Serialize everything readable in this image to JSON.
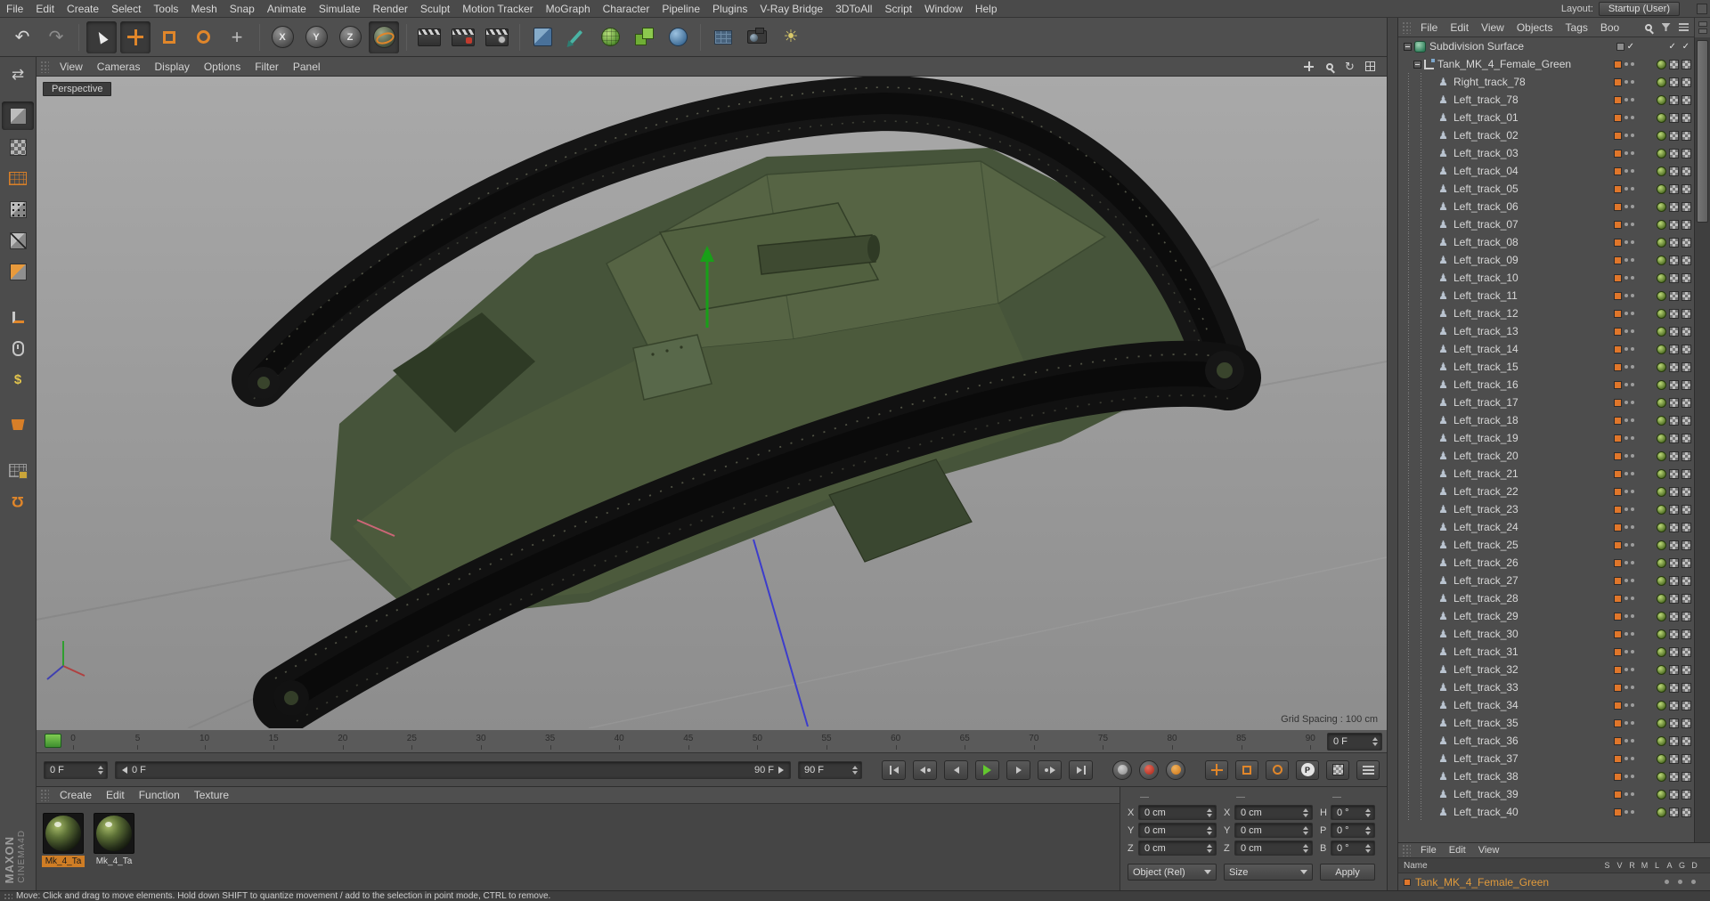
{
  "menubar": {
    "items": [
      "File",
      "Edit",
      "Create",
      "Select",
      "Tools",
      "Mesh",
      "Snap",
      "Animate",
      "Simulate",
      "Render",
      "Sculpt",
      "Motion Tracker",
      "MoGraph",
      "Character",
      "Pipeline",
      "Plugins",
      "V-Ray Bridge",
      "3DToAll",
      "Script",
      "Window",
      "Help"
    ],
    "layout_label": "Layout:",
    "layout_value": "Startup (User)"
  },
  "toolbar": {
    "axis_x": "X",
    "axis_y": "Y",
    "axis_z": "Z"
  },
  "viewport": {
    "menu": [
      "View",
      "Cameras",
      "Display",
      "Options",
      "Filter",
      "Panel"
    ],
    "label": "Perspective",
    "grid_spacing": "Grid Spacing : 100 cm"
  },
  "timeline": {
    "ticks": [
      "0",
      "5",
      "10",
      "15",
      "20",
      "25",
      "30",
      "35",
      "40",
      "45",
      "50",
      "55",
      "60",
      "65",
      "70",
      "75",
      "80",
      "85",
      "90"
    ],
    "ruler_field": "0 F",
    "frame_spinner": "0 F",
    "range_start": "0 F",
    "range_end": "90 F",
    "end_spinner": "90 F",
    "pla_label": "P"
  },
  "materials": {
    "menu": [
      "Create",
      "Edit",
      "Function",
      "Texture"
    ],
    "items": [
      {
        "name": "Mk_4_Ta",
        "state": "selected"
      },
      {
        "name": "Mk_4_Ta",
        "state": "plain"
      }
    ]
  },
  "coordinates": {
    "dash": "—",
    "rows": [
      {
        "l1": "X",
        "v1": "0 cm",
        "l2": "X",
        "v2": "0 cm",
        "l3": "H",
        "v3": "0 °"
      },
      {
        "l1": "Y",
        "v1": "0 cm",
        "l2": "Y",
        "v2": "0 cm",
        "l3": "P",
        "v3": "0 °"
      },
      {
        "l1": "Z",
        "v1": "0 cm",
        "l2": "Z",
        "v2": "0 cm",
        "l3": "B",
        "v3": "0 °"
      }
    ],
    "dropdown_object": "Object (Rel)",
    "dropdown_size": "Size",
    "apply_label": "Apply"
  },
  "object_manager": {
    "menu": [
      "File",
      "Edit",
      "View",
      "Objects",
      "Tags",
      "Boo"
    ],
    "tree": [
      {
        "label": "Subdivision Surface",
        "type": "gen"
      },
      {
        "label": "Tank_MK_4_Female_Green",
        "type": "nullobj"
      },
      {
        "label": "Right_track_78",
        "type": "track"
      },
      {
        "label": "Left_track_78",
        "type": "track"
      },
      {
        "label": "Left_track_01",
        "type": "track"
      },
      {
        "label": "Left_track_02",
        "type": "track"
      },
      {
        "label": "Left_track_03",
        "type": "track"
      },
      {
        "label": "Left_track_04",
        "type": "track"
      },
      {
        "label": "Left_track_05",
        "type": "track"
      },
      {
        "label": "Left_track_06",
        "type": "track"
      },
      {
        "label": "Left_track_07",
        "type": "track"
      },
      {
        "label": "Left_track_08",
        "type": "track"
      },
      {
        "label": "Left_track_09",
        "type": "track"
      },
      {
        "label": "Left_track_10",
        "type": "track"
      },
      {
        "label": "Left_track_11",
        "type": "track"
      },
      {
        "label": "Left_track_12",
        "type": "track"
      },
      {
        "label": "Left_track_13",
        "type": "track"
      },
      {
        "label": "Left_track_14",
        "type": "track"
      },
      {
        "label": "Left_track_15",
        "type": "track"
      },
      {
        "label": "Left_track_16",
        "type": "track"
      },
      {
        "label": "Left_track_17",
        "type": "track"
      },
      {
        "label": "Left_track_18",
        "type": "track"
      },
      {
        "label": "Left_track_19",
        "type": "track"
      },
      {
        "label": "Left_track_20",
        "type": "track"
      },
      {
        "label": "Left_track_21",
        "type": "track"
      },
      {
        "label": "Left_track_22",
        "type": "track"
      },
      {
        "label": "Left_track_23",
        "type": "track"
      },
      {
        "label": "Left_track_24",
        "type": "track"
      },
      {
        "label": "Left_track_25",
        "type": "track"
      },
      {
        "label": "Left_track_26",
        "type": "track"
      },
      {
        "label": "Left_track_27",
        "type": "track"
      },
      {
        "label": "Left_track_28",
        "type": "track"
      },
      {
        "label": "Left_track_29",
        "type": "track"
      },
      {
        "label": "Left_track_30",
        "type": "track"
      },
      {
        "label": "Left_track_31",
        "type": "track"
      },
      {
        "label": "Left_track_32",
        "type": "track"
      },
      {
        "label": "Left_track_33",
        "type": "track"
      },
      {
        "label": "Left_track_34",
        "type": "track"
      },
      {
        "label": "Left_track_35",
        "type": "track"
      },
      {
        "label": "Left_track_36",
        "type": "track"
      },
      {
        "label": "Left_track_37",
        "type": "track"
      },
      {
        "label": "Left_track_38",
        "type": "track"
      },
      {
        "label": "Left_track_39",
        "type": "track"
      },
      {
        "label": "Left_track_40",
        "type": "track"
      }
    ]
  },
  "attribute_panel": {
    "menu": [
      "File",
      "Edit",
      "View"
    ],
    "name_header": "Name",
    "columns": [
      "S",
      "V",
      "R",
      "M",
      "L",
      "A",
      "G",
      "D"
    ],
    "row_name": "Tank_MK_4_Female_Green"
  },
  "status_bar": {
    "text": "Move: Click and drag to move elements. Hold down SHIFT to quantize movement / add to the selection in point mode, CTRL to remove."
  },
  "brand": {
    "line1": "MAXON",
    "line2": "CINEMA4D"
  }
}
